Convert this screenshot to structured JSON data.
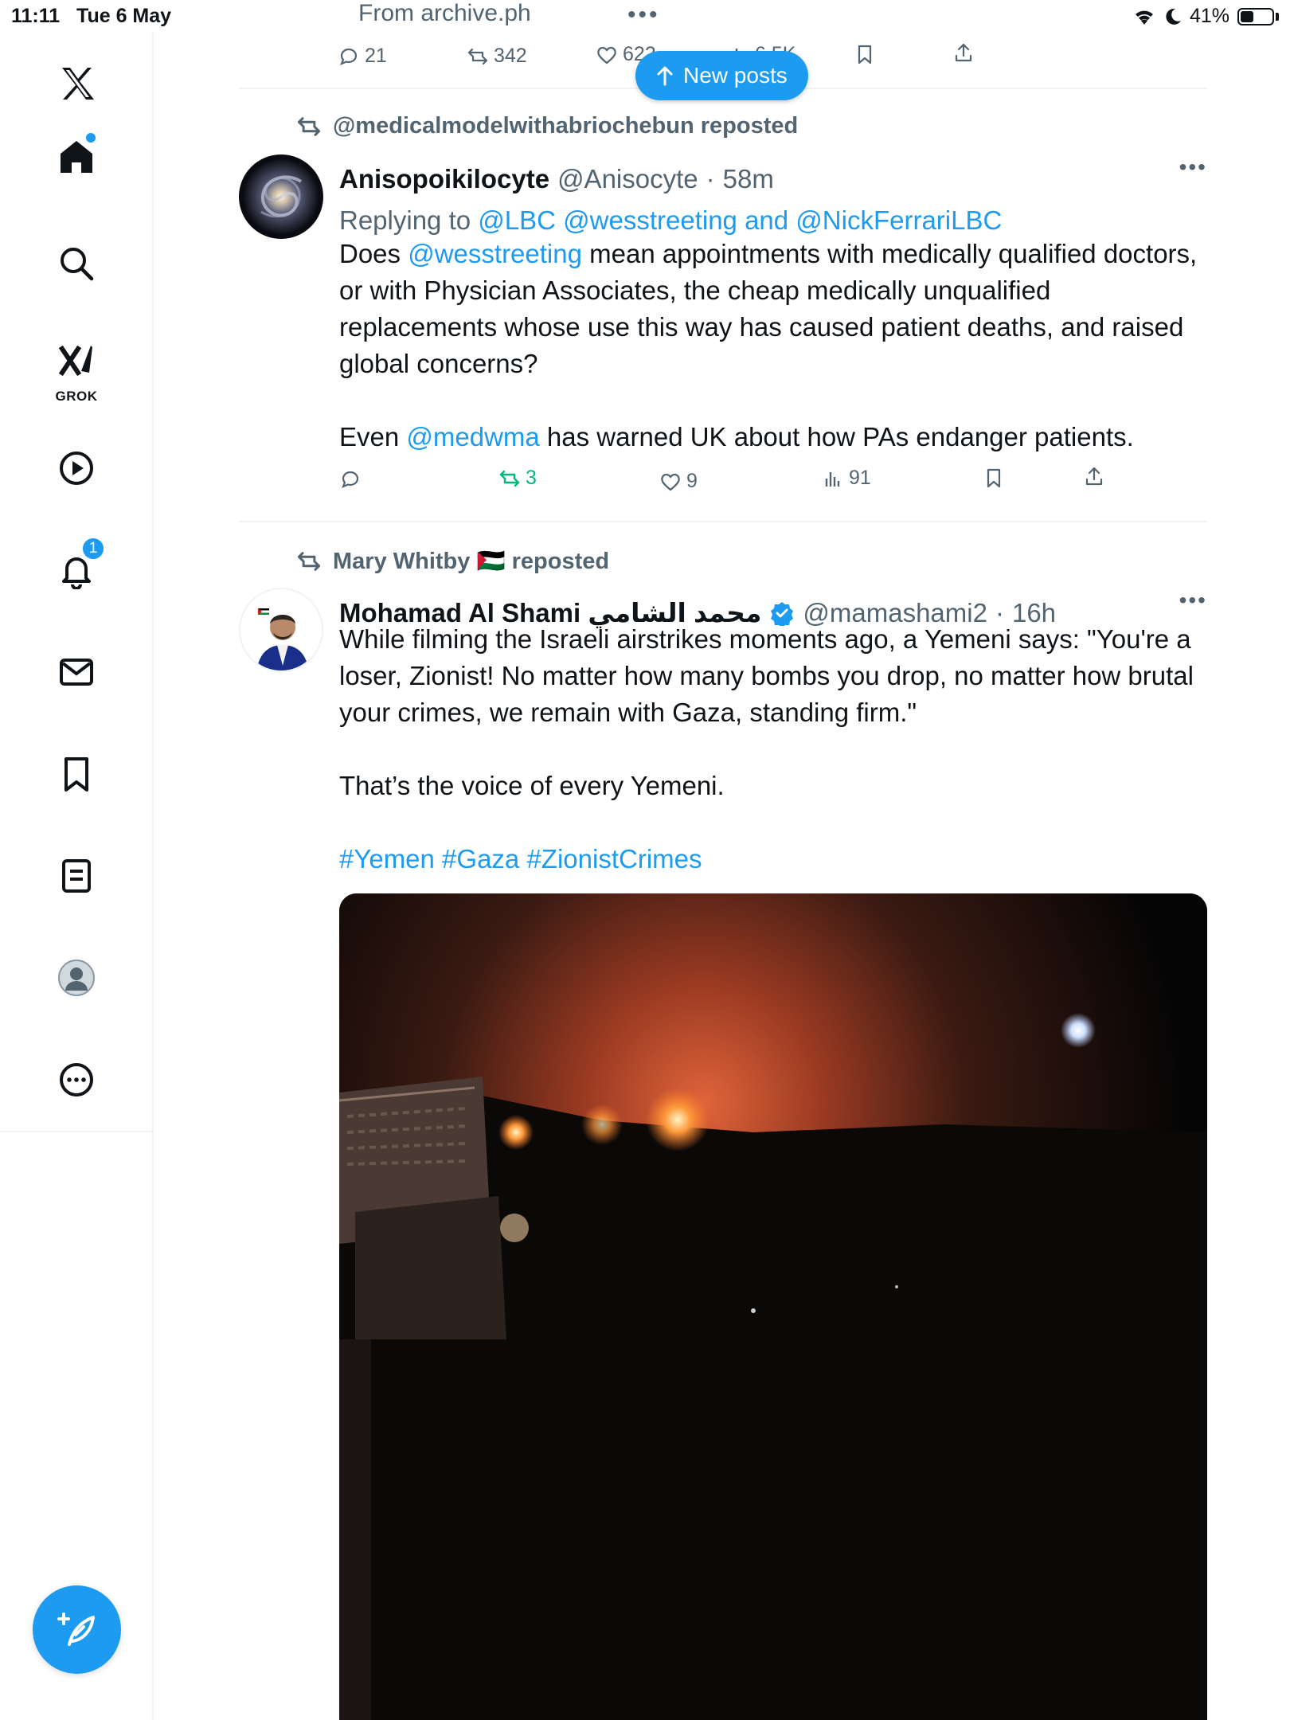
{
  "status_bar": {
    "time": "11:11",
    "date": "Tue 6 May",
    "battery": "41%",
    "battery_level": 0.41
  },
  "sidebar": {
    "items": [
      {
        "name": "home",
        "has_dot": true
      },
      {
        "name": "explore"
      },
      {
        "name": "grok",
        "label": "GROK"
      },
      {
        "name": "video"
      },
      {
        "name": "notifications",
        "badge": "1"
      },
      {
        "name": "messages"
      },
      {
        "name": "bookmarks"
      },
      {
        "name": "lists"
      },
      {
        "name": "profile"
      },
      {
        "name": "more"
      }
    ]
  },
  "top_tweet": {
    "source": "From archive.ph",
    "replies": "21",
    "reposts": "342",
    "likes": "622",
    "views": "6.5K"
  },
  "new_posts": {
    "label": "New posts"
  },
  "tweets": [
    {
      "reposted_by": "@medicalmodelwithabriochebun reposted",
      "display_name": "Anisopoikilocyte",
      "handle": "@Anisocyte",
      "time": "58m",
      "replying_to_prefix": "Replying to",
      "replying_to": "@LBC @wesstreeting and @NickFerrariLBC",
      "body": [
        {
          "prefix": "Does ",
          "mention": "@wesstreeting",
          "text": " mean appointments with medically qualified doctors, or with Physician Associates, the cheap medically unqualified replacements whose use this way has caused patient deaths, and raised global concerns?"
        },
        {
          "prefix": "Even ",
          "mention": "@medwma",
          "text": " has warned UK about how PAs endanger patients."
        }
      ],
      "replies": "",
      "reposts": "3",
      "likes": "9",
      "views": "91"
    },
    {
      "reposted_by": "Mary Whitby 🇵🇸 reposted",
      "display_name": "Mohamad Al Shami محمد الشامي",
      "handle": "@mamashami2",
      "time": "16h",
      "body": [
        "While filming the Israeli airstrikes moments ago, a Yemeni says: \"You're a loser, Zionist! No matter how many bombs you drop, no matter how brutal your crimes, we remain with Gaza, standing firm.\"",
        "That’s the voice of every Yemeni."
      ],
      "hashtags": "#Yemen #Gaza #ZionistCrimes"
    }
  ],
  "colors": {
    "accent": "#1d9bf0",
    "repost_green": "#00ba7c",
    "secondary_text": "#536471",
    "divider": "#eff3f4"
  }
}
